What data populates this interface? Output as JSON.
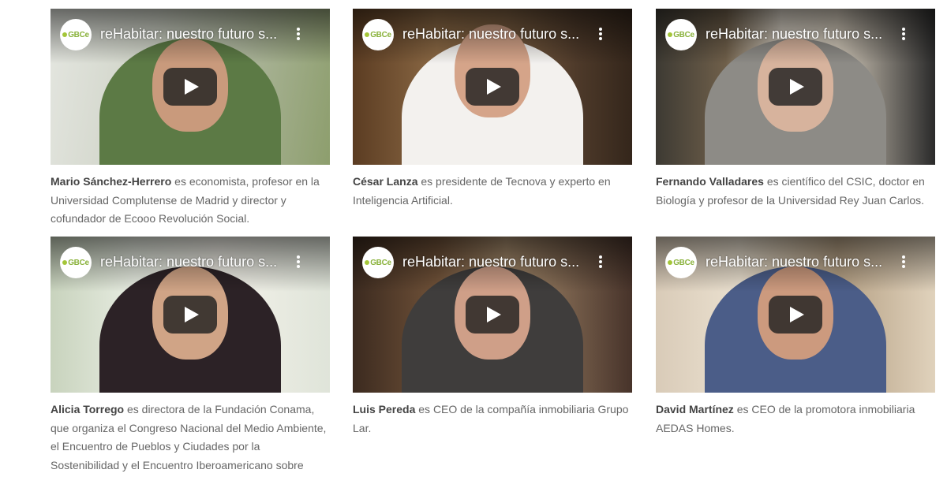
{
  "channel_logo": "GBCe",
  "cards": [
    {
      "video_title": "reHabitar: nuestro futuro s...",
      "name": "Mario Sánchez-Herrero",
      "bio": " es economista, profesor en la Universidad Complutense de Madrid y director y cofundador de Ecooo Revolución Social."
    },
    {
      "video_title": "reHabitar: nuestro futuro s...",
      "name": "César Lanza",
      "bio": " es presidente de Tecnova y experto en Inteligencia Artificial."
    },
    {
      "video_title": "reHabitar: nuestro futuro s...",
      "name": "Fernando Valladares",
      "bio": " es científico del CSIC, doctor en Biología y profesor de la Universidad Rey Juan Carlos."
    },
    {
      "video_title": "reHabitar: nuestro futuro s...",
      "name": "Alicia Torrego",
      "bio": " es directora de la Fundación Conama, que organiza el Congreso Nacional del Medio Ambiente, el Encuentro de Pueblos y Ciudades por la Sostenibilidad y el Encuentro Iberoamericano sobre"
    },
    {
      "video_title": "reHabitar: nuestro futuro s...",
      "name": "Luis Pereda",
      "bio": " es CEO de la compañía inmobiliaria Grupo Lar."
    },
    {
      "video_title": "reHabitar: nuestro futuro s...",
      "name": "David Martínez",
      "bio": " es CEO de la promotora inmobiliaria AEDAS Homes."
    }
  ]
}
